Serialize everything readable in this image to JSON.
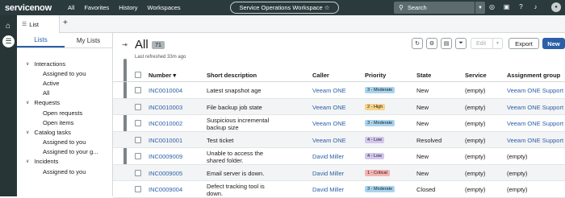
{
  "topbar": {
    "logo": "servicenow",
    "nav": [
      "All",
      "Favorites",
      "History",
      "Workspaces"
    ],
    "workspace": "Service Operations Workspace ☆",
    "search_placeholder": "Search"
  },
  "tabs": {
    "list_tab": "List",
    "add": "+"
  },
  "sidebar": {
    "tab_lists": "Lists",
    "tab_mylists": "My Lists",
    "tree": [
      {
        "type": "grp",
        "label": "Interactions"
      },
      {
        "type": "leaf",
        "label": "Assigned to you"
      },
      {
        "type": "leaf",
        "label": "Active"
      },
      {
        "type": "leaf",
        "label": "All"
      },
      {
        "type": "grp",
        "label": "Requests"
      },
      {
        "type": "leaf",
        "label": "Open requests"
      },
      {
        "type": "leaf",
        "label": "Open items"
      },
      {
        "type": "grp",
        "label": "Catalog tasks"
      },
      {
        "type": "leaf",
        "label": "Assigned to you"
      },
      {
        "type": "leaf",
        "label": "Assigned to your g..."
      },
      {
        "type": "grp",
        "label": "Incidents"
      },
      {
        "type": "leaf",
        "label": "Assigned to you"
      }
    ]
  },
  "main": {
    "title": "All",
    "count": "71",
    "refreshed": "Last refreshed 33m ago",
    "edit_label": "Edit",
    "export_label": "Export",
    "new_label": "New",
    "columns": {
      "number": "Number ▾",
      "short_description": "Short description",
      "caller": "Caller",
      "priority": "Priority",
      "state": "State",
      "service": "Service",
      "assignment_group": "Assignment group"
    },
    "rows": [
      {
        "number": "INC0010004",
        "desc": "Latest snapshot age",
        "caller": "Veeam ONE",
        "priority": "3 - Moderate",
        "pcolor": "#a9d4ef",
        "state": "New",
        "service": "(empty)",
        "group": "Veeam ONE Support",
        "group_link": true
      },
      {
        "number": "INC0010003",
        "desc": "File backup job state",
        "caller": "Veeam ONE",
        "priority": "2 - High",
        "pcolor": "#f7d48a",
        "state": "New",
        "service": "(empty)",
        "group": "Veeam ONE Support",
        "group_link": true
      },
      {
        "number": "INC0010002",
        "desc": "Suspicious incremental backup size",
        "caller": "Veeam ONE",
        "priority": "3 - Moderate",
        "pcolor": "#a9d4ef",
        "state": "New",
        "service": "(empty)",
        "group": "Veeam ONE Support",
        "group_link": true
      },
      {
        "number": "INC0010001",
        "desc": "Test ticket",
        "caller": "Veeam ONE",
        "priority": "4 - Low",
        "pcolor": "#d3c6ef",
        "state": "Resolved",
        "service": "(empty)",
        "group": "Veeam ONE Support",
        "group_link": true
      },
      {
        "number": "INC0009009",
        "desc": "Unable to access the shared folder.",
        "caller": "David Miller",
        "priority": "4 - Low",
        "pcolor": "#d3c6ef",
        "state": "New",
        "service": "(empty)",
        "group": "(empty)",
        "group_link": false
      },
      {
        "number": "INC0009005",
        "desc": "Email server is down.",
        "caller": "David Miller",
        "priority": "1 - Critical",
        "pcolor": "#f5b3b3",
        "state": "New",
        "service": "(empty)",
        "group": "(empty)",
        "group_link": false
      },
      {
        "number": "INC0009004",
        "desc": "Defect tracking tool is down.",
        "caller": "David Miller",
        "priority": "3 - Moderate",
        "pcolor": "#a9d4ef",
        "state": "Closed",
        "service": "(empty)",
        "group": "(empty)",
        "group_link": false
      }
    ]
  }
}
